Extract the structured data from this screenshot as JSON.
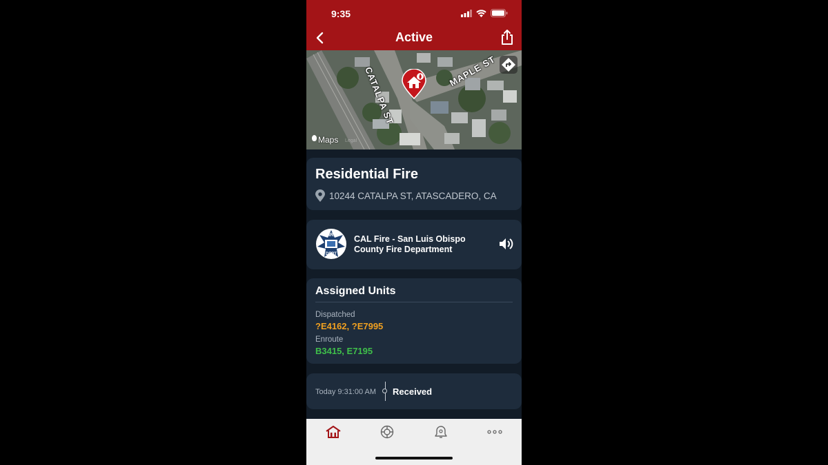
{
  "status_bar": {
    "time": "9:35"
  },
  "header": {
    "title": "Active",
    "color": "#a31417"
  },
  "map": {
    "street_label_1": "CATALPA ST",
    "street_label_2": "MAPLE ST",
    "attribution": "Maps",
    "legal": "Legal"
  },
  "incident": {
    "title": "Residential Fire",
    "address": "10244 CATALPA ST, ATASCADERO, CA"
  },
  "department": {
    "name": "CAL Fire - San Luis Obispo County Fire Department",
    "logo_text_top": "FIRE",
    "logo_text_bottom": "DEPT"
  },
  "assigned_units": {
    "title": "Assigned Units",
    "groups": [
      {
        "label": "Dispatched",
        "units": "?E4162, ?E7995",
        "color": "#f0a020"
      },
      {
        "label": "Enroute",
        "units": "B3415, E7195",
        "color": "#3fbf4a"
      }
    ]
  },
  "timeline": {
    "time": "Today 9:31:00 AM",
    "event": "Received"
  },
  "tabbar": {
    "items": [
      "home-icon",
      "fire-department-icon",
      "alerts-icon",
      "more-icon"
    ],
    "active_color": "#a31417"
  }
}
